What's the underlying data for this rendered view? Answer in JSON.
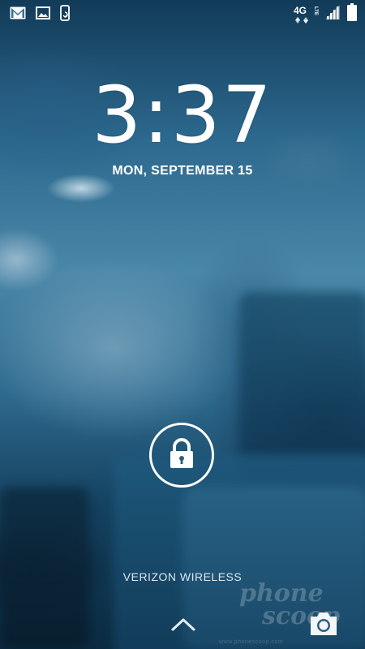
{
  "status_bar": {
    "left_icons": [
      "gmail-icon",
      "gallery-icon",
      "phone-sync-icon"
    ],
    "network_type": "4G",
    "network_subtype": "LTE",
    "right_icons": [
      "network-4g-lte-icon",
      "signal-strength-icon",
      "battery-icon"
    ]
  },
  "lockscreen": {
    "time": "3:37",
    "date": "MON, SEPTEMBER 15",
    "carrier": "VERIZON WIRELESS"
  },
  "controls": {
    "unlock_icon": "padlock-icon",
    "swipe_icon": "chevron-up-icon",
    "camera_icon": "camera-icon"
  },
  "watermark": {
    "line1": "phone",
    "line2": "scoop",
    "footer": "www.phonescoop.com"
  },
  "colors": {
    "text_primary": "#ffffff",
    "wallpaper_base": "#2d6a8f",
    "wallpaper_dark": "#0b2a40"
  }
}
